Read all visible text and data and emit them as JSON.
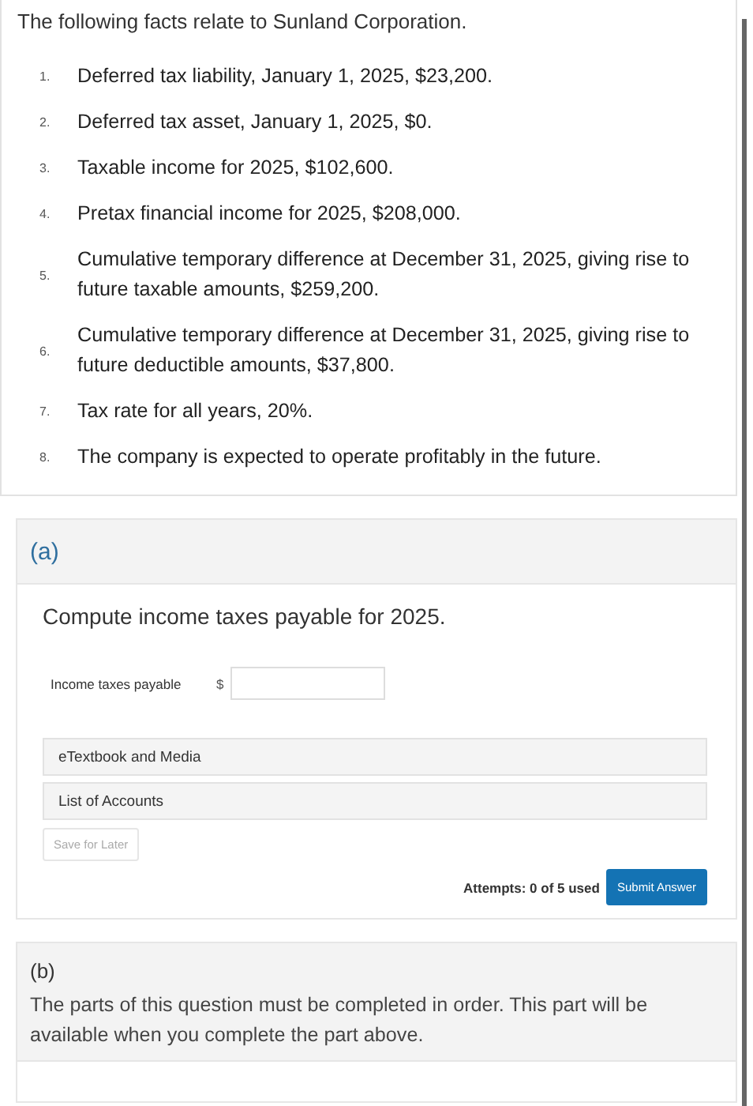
{
  "intro": "The following facts relate to Sunland Corporation.",
  "facts": [
    {
      "number": "1.",
      "text": "Deferred tax liability, January 1, 2025, $23,200."
    },
    {
      "number": "2.",
      "text": "Deferred tax asset, January 1, 2025, $0."
    },
    {
      "number": "3.",
      "text": "Taxable income for 2025, $102,600."
    },
    {
      "number": "4.",
      "text": "Pretax financial income for 2025, $208,000."
    },
    {
      "number": "5.",
      "text": "Cumulative temporary difference at December 31, 2025, giving rise to future taxable amounts, $259,200."
    },
    {
      "number": "6.",
      "text": "Cumulative temporary difference at December 31, 2025, giving rise to future deductible amounts, $37,800."
    },
    {
      "number": "7.",
      "text": "Tax rate for all years, 20%."
    },
    {
      "number": "8.",
      "text": "The company is expected to operate profitably in the future."
    }
  ],
  "part_a": {
    "label": "(a)",
    "question": "Compute income taxes payable for 2025.",
    "field": {
      "label": "Income taxes payable",
      "prefix": "$"
    },
    "resources": [
      "eTextbook and Media",
      "List of Accounts"
    ],
    "save_button": {
      "label": "Save for Later",
      "disabled": true
    },
    "attempts": "Attempts: 0 of 5 used",
    "submit_button": "Submit Answer"
  },
  "part_b": {
    "label": "(b)",
    "message": "The parts of this question must be completed in order. This part will be available when you complete the part above."
  }
}
